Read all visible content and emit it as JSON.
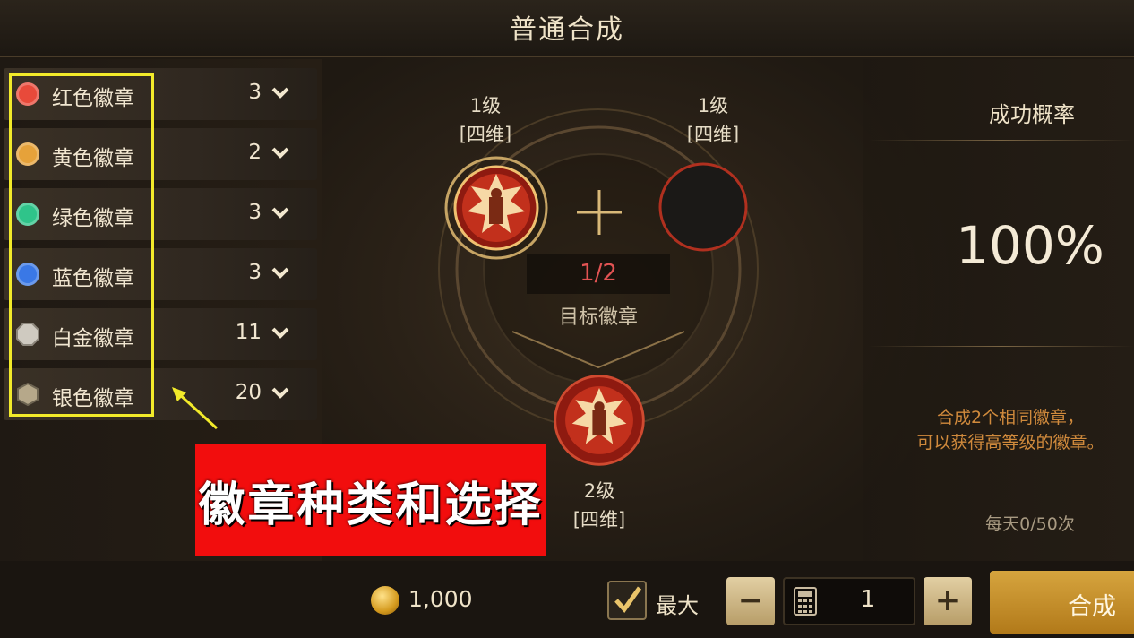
{
  "title": "普通合成",
  "badges": [
    {
      "name": "红色徽章",
      "count": "3",
      "color": "#e84a3a"
    },
    {
      "name": "黄色徽章",
      "count": "2",
      "color": "#e6a23a"
    },
    {
      "name": "绿色徽章",
      "count": "3",
      "color": "#2fc48a"
    },
    {
      "name": "蓝色徽章",
      "count": "3",
      "color": "#3a78e6"
    },
    {
      "name": "白金徽章",
      "count": "11",
      "color": "#cfcac0"
    },
    {
      "name": "银色徽章",
      "count": "20",
      "color": "#b6a88a"
    }
  ],
  "annotation": {
    "label": "徽章种类和选择",
    "box_color": "#f2ea2a",
    "label_bg": "#f20d0d"
  },
  "synthesis": {
    "slot_left": {
      "level": "1级",
      "type": "[四维]"
    },
    "slot_right": {
      "level": "1级",
      "type": "[四维]"
    },
    "ratio": "1/2",
    "target_label": "目标徽章",
    "result": {
      "level": "2级",
      "type": "[四维]"
    }
  },
  "success": {
    "title": "成功概率",
    "percent": "100%",
    "desc_line1": "合成2个相同徽章，",
    "desc_line2": "可以获得高等级的徽章。",
    "daily": "每天0/50次"
  },
  "bottom": {
    "gold": "1,000",
    "max_label": "最大",
    "max_checked": true,
    "minus": "−",
    "quantity": "1",
    "plus": "+",
    "synthesize": "合成"
  }
}
